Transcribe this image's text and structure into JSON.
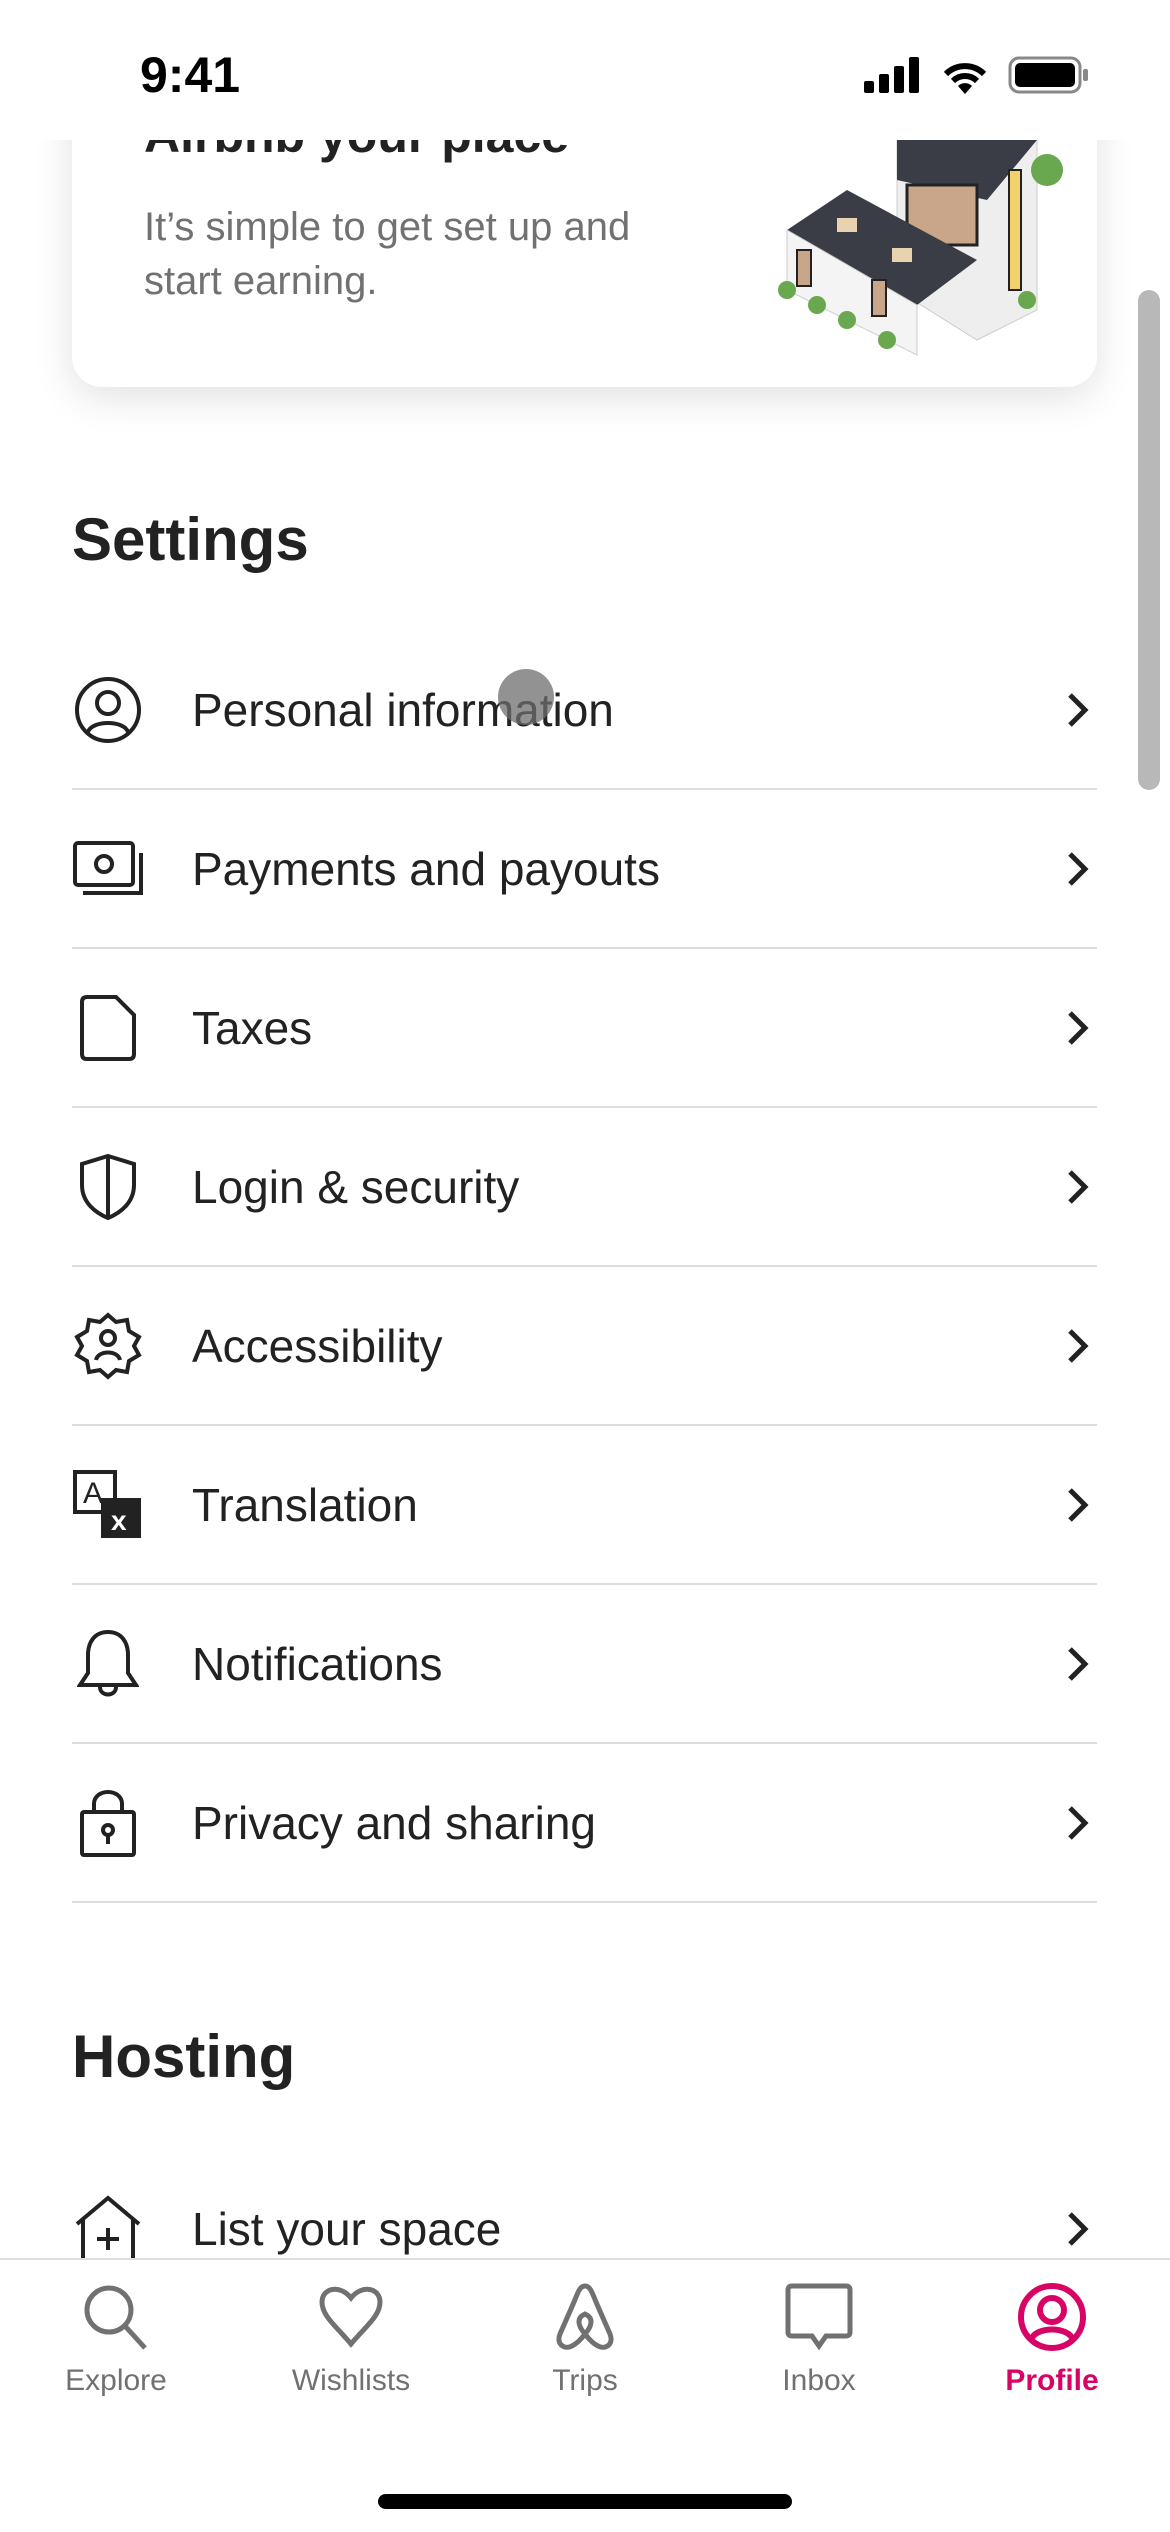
{
  "status_bar": {
    "time": "9:41"
  },
  "promo_card": {
    "title": "Airbnb your place",
    "subtitle": "It’s simple to get set up and start earning."
  },
  "settings": {
    "heading": "Settings",
    "items": [
      {
        "label": "Personal information",
        "icon": "user-circle-icon"
      },
      {
        "label": "Payments and payouts",
        "icon": "payments-icon"
      },
      {
        "label": "Taxes",
        "icon": "document-icon"
      },
      {
        "label": "Login & security",
        "icon": "shield-icon"
      },
      {
        "label": "Accessibility",
        "icon": "accessibility-gear-icon"
      },
      {
        "label": "Translation",
        "icon": "translate-icon"
      },
      {
        "label": "Notifications",
        "icon": "bell-icon"
      },
      {
        "label": "Privacy and sharing",
        "icon": "lock-icon"
      }
    ]
  },
  "hosting": {
    "heading": "Hosting",
    "items": [
      {
        "label": "List your space",
        "icon": "house-plus-icon"
      }
    ]
  },
  "tabbar": {
    "active_color": "#d70466",
    "tabs": [
      {
        "label": "Explore",
        "icon": "search-icon"
      },
      {
        "label": "Wishlists",
        "icon": "heart-icon"
      },
      {
        "label": "Trips",
        "icon": "airbnb-logo-icon"
      },
      {
        "label": "Inbox",
        "icon": "message-icon"
      },
      {
        "label": "Profile",
        "icon": "profile-icon",
        "active": true
      }
    ]
  }
}
